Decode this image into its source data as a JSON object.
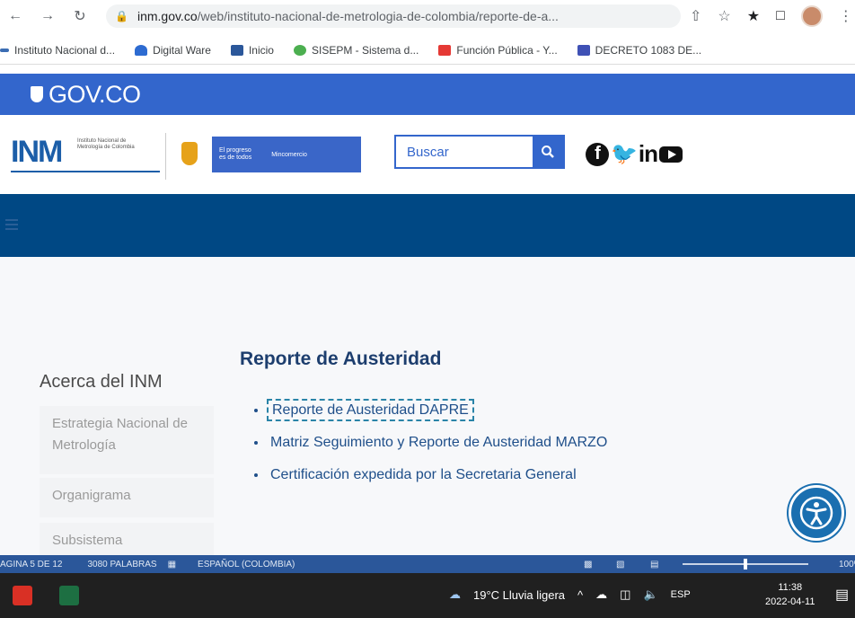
{
  "browser": {
    "url_domain": "inm.gov.co",
    "url_path": "/web/instituto-nacional-de-metrologia-de-colombia/reporte-de-a...",
    "bookmarks": [
      {
        "label": "Instituto Nacional d...",
        "color": "#3b6db3"
      },
      {
        "label": "Digital Ware",
        "color": "#2d6bd1"
      },
      {
        "label": "Inicio",
        "color": "#2b579a"
      },
      {
        "label": "SISEPM - Sistema d...",
        "color": "#4caf50"
      },
      {
        "label": "Función Pública - Y...",
        "color": "#e53935"
      },
      {
        "label": "DECRETO 1083 DE...",
        "color": "#3f51b5"
      }
    ]
  },
  "gov_bar": {
    "label": "GOV.CO",
    "color": "#3366cc"
  },
  "header": {
    "search_placeholder": "Buscar",
    "prog_line1": "El progreso",
    "prog_line2": "es de todos",
    "prog_right": "Mincomercio"
  },
  "sidebar": {
    "title": "Acerca del INM",
    "items": [
      {
        "label": "Estrategia Nacional de Metrología"
      },
      {
        "label": "Organigrama"
      },
      {
        "label": "Subsistema"
      }
    ]
  },
  "content": {
    "title": "Reporte de Austeridad",
    "links": [
      {
        "label": "Reporte de Austeridad DAPRE"
      },
      {
        "label": "Matriz Seguimiento y Reporte de Austeridad MARZO"
      },
      {
        "label": "Certificación expedida por la Secretaria General"
      }
    ]
  },
  "word_status": {
    "page": "AGINA 5 DE 12",
    "words": "3080 PALABRAS",
    "language": "ESPAÑOL (COLOMBIA)",
    "zoom": "100%"
  },
  "taskbar": {
    "weather": "19°C  Lluvia ligera",
    "lang": "ESP",
    "time": "11:38",
    "date": "2022-04-11"
  }
}
